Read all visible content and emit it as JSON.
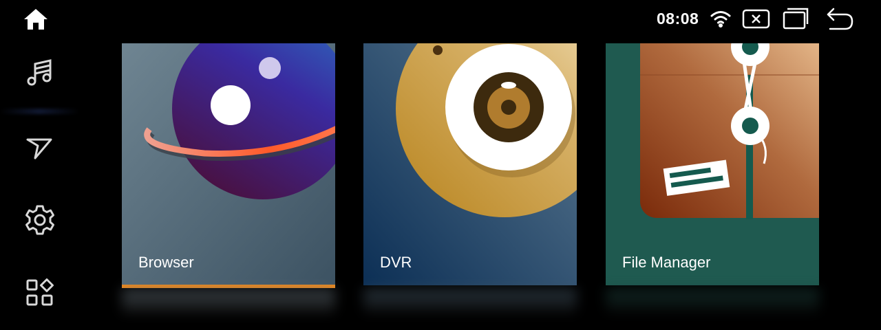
{
  "status": {
    "time": "08:08",
    "icons": [
      "wifi-icon",
      "close-window-icon",
      "recent-apps-icon",
      "back-icon"
    ]
  },
  "sidebar": {
    "items": [
      {
        "name": "home-icon"
      },
      {
        "name": "music-icon"
      },
      {
        "name": "navigation-icon"
      },
      {
        "name": "settings-icon"
      },
      {
        "name": "apps-grid-icon"
      }
    ]
  },
  "apps": [
    {
      "label": "Browser",
      "focused": true
    },
    {
      "label": "DVR",
      "focused": false
    },
    {
      "label": "File Manager",
      "focused": false
    }
  ],
  "colors": {
    "focus_accent": "#f08a1c",
    "browser_bg": "#4a6070",
    "dvr_bg": "#2a4f6e",
    "file_bg": "#1f5a50"
  }
}
